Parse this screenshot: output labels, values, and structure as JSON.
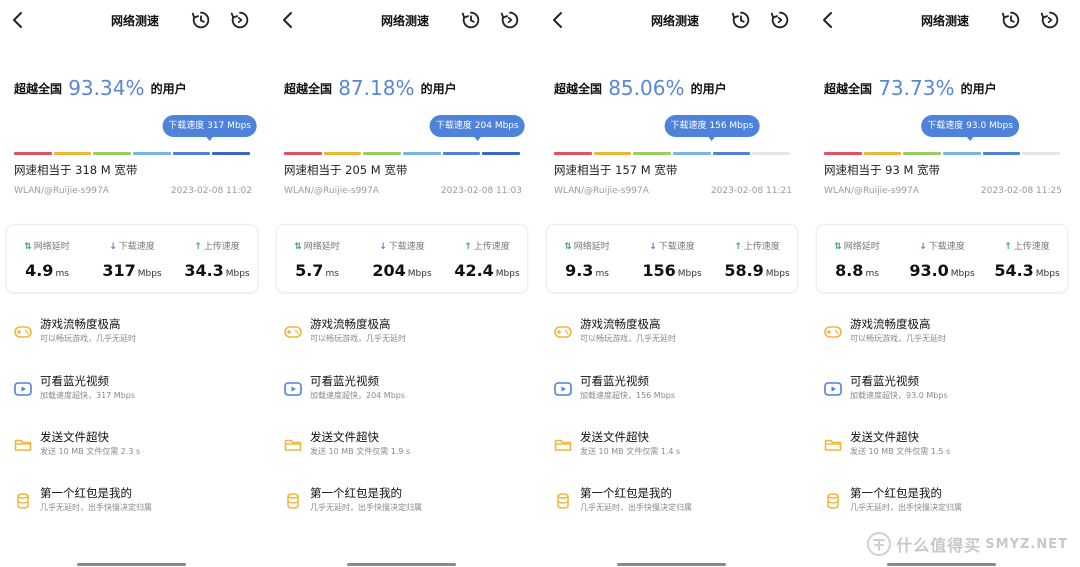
{
  "colors": {
    "accent": "#4f82da",
    "percent": "#5a85d8",
    "arrow_green": "#3aa57a",
    "icon_orange": "#f0b63a",
    "icon_blue": "#4f82da",
    "speedbar": [
      "#e0505f",
      "#f0b33c",
      "#9ccc63",
      "#79b6e8",
      "#4f82da",
      "#3a66c4"
    ],
    "speedbar_inactive": "#e6e6e6"
  },
  "screens": [
    {
      "title": "网络测速",
      "percent_prefix": "超越全国",
      "percent": "93.34%",
      "percent_suffix": "的用户",
      "bubble": "下载速度 317 Mbps",
      "bubble_position_fraction": 0.88,
      "speedbar_active_segments": 6,
      "broadband": "网速相当于 318 M 宽带",
      "network": "WLAN/@Ruijie-s997A",
      "time": "2023-02-08 11:02",
      "stats": [
        {
          "label": "网络延时",
          "value": "4.9",
          "unit": "ms"
        },
        {
          "label": "下载速度",
          "value": "317",
          "unit": "Mbps"
        },
        {
          "label": "上传速度",
          "value": "34.3",
          "unit": "Mbps"
        }
      ],
      "features": [
        {
          "icon": "gamepad-icon",
          "title": "游戏流畅度极高",
          "subtitle": "可以畅玩游戏，几乎无延时"
        },
        {
          "icon": "play-icon",
          "title": "可看蓝光视频",
          "subtitle": "加载速度超快，317 Mbps"
        },
        {
          "icon": "folder-icon",
          "title": "发送文件超快",
          "subtitle": "发送 10 MB 文件仅需 2.3 s"
        },
        {
          "icon": "coin-stack-icon",
          "title": "第一个红包是我的",
          "subtitle": "几乎无延时，出手快慢决定归属"
        }
      ]
    },
    {
      "title": "网络测速",
      "percent_prefix": "超越全国",
      "percent": "87.18%",
      "percent_suffix": "的用户",
      "bubble": "下载速度 204 Mbps",
      "bubble_position_fraction": 0.87,
      "speedbar_active_segments": 6,
      "broadband": "网速相当于 205 M 宽带",
      "network": "WLAN/@Ruijie-s997A",
      "time": "2023-02-08 11:03",
      "stats": [
        {
          "label": "网络延时",
          "value": "5.7",
          "unit": "ms"
        },
        {
          "label": "下载速度",
          "value": "204",
          "unit": "Mbps"
        },
        {
          "label": "上传速度",
          "value": "42.4",
          "unit": "Mbps"
        }
      ],
      "features": [
        {
          "icon": "gamepad-icon",
          "title": "游戏流畅度极高",
          "subtitle": "可以畅玩游戏，几乎无延时"
        },
        {
          "icon": "play-icon",
          "title": "可看蓝光视频",
          "subtitle": "加载速度超快，204 Mbps"
        },
        {
          "icon": "folder-icon",
          "title": "发送文件超快",
          "subtitle": "发送 10 MB 文件仅需 1.9 s"
        },
        {
          "icon": "coin-stack-icon",
          "title": "第一个红包是我的",
          "subtitle": "几乎无延时，出手快慢决定归属"
        }
      ]
    },
    {
      "title": "网络测速",
      "percent_prefix": "超越全国",
      "percent": "85.06%",
      "percent_suffix": "的用户",
      "bubble": "下载速度 156 Mbps",
      "bubble_position_fraction": 0.72,
      "speedbar_active_segments": 5,
      "broadband": "网速相当于 157 M 宽带",
      "network": "WLAN/@Ruijie-s997A",
      "time": "2023-02-08 11:21",
      "stats": [
        {
          "label": "网络延时",
          "value": "9.3",
          "unit": "ms"
        },
        {
          "label": "下载速度",
          "value": "156",
          "unit": "Mbps"
        },
        {
          "label": "上传速度",
          "value": "58.9",
          "unit": "Mbps"
        }
      ],
      "features": [
        {
          "icon": "gamepad-icon",
          "title": "游戏流畅度极高",
          "subtitle": "可以畅玩游戏，几乎无延时"
        },
        {
          "icon": "play-icon",
          "title": "可看蓝光视频",
          "subtitle": "加载速度超快，156 Mbps"
        },
        {
          "icon": "folder-icon",
          "title": "发送文件超快",
          "subtitle": "发送 10 MB 文件仅需 1.4 s"
        },
        {
          "icon": "coin-stack-icon",
          "title": "第一个红包是我的",
          "subtitle": "几乎无延时，出手快慢决定归属"
        }
      ]
    },
    {
      "title": "网络测速",
      "percent_prefix": "超越全国",
      "percent": "73.73%",
      "percent_suffix": "的用户",
      "bubble": "下载速度 93.0 Mbps",
      "bubble_position_fraction": 0.67,
      "speedbar_active_segments": 5,
      "broadband": "网速相当于 93 M 宽带",
      "network": "WLAN/@Ruijie-s997A",
      "time": "2023-02-08 11:25",
      "stats": [
        {
          "label": "网络延时",
          "value": "8.8",
          "unit": "ms"
        },
        {
          "label": "下载速度",
          "value": "93.0",
          "unit": "Mbps"
        },
        {
          "label": "上传速度",
          "value": "54.3",
          "unit": "Mbps"
        }
      ],
      "features": [
        {
          "icon": "gamepad-icon",
          "title": "游戏流畅度极高",
          "subtitle": "可以畅玩游戏，几乎无延时"
        },
        {
          "icon": "play-icon",
          "title": "可看蓝光视频",
          "subtitle": "加载速度超快，93.0 Mbps"
        },
        {
          "icon": "folder-icon",
          "title": "发送文件超快",
          "subtitle": "发送 10 MB 文件仅需 1.5 s"
        },
        {
          "icon": "coin-stack-icon",
          "title": "第一个红包是我的",
          "subtitle": "几乎无延时，出手快慢决定归属"
        }
      ]
    }
  ],
  "watermark": {
    "text": "什么值得买",
    "url_text": "SMYZ.NET"
  }
}
